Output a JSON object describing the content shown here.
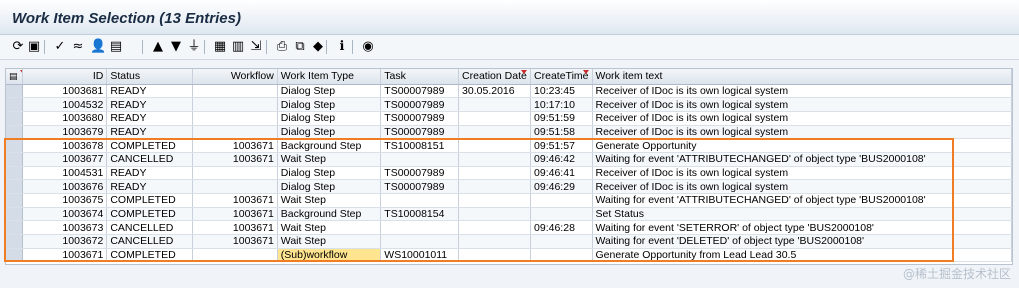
{
  "window": {
    "title": "Work Item Selection (13 Entries)"
  },
  "toolbar": {
    "buttons": [
      {
        "name": "refresh-icon",
        "glyph": "⟳"
      },
      {
        "name": "save-icon",
        "glyph": "▣"
      },
      {
        "name": "execute-icon",
        "glyph": "✓"
      },
      {
        "name": "workflow-log-icon",
        "glyph": "≈"
      },
      {
        "name": "agent-icon",
        "glyph": "👤"
      },
      {
        "name": "details-icon",
        "glyph": "▤"
      },
      {
        "name": "sort-ascending-icon",
        "glyph": "▲"
      },
      {
        "name": "sort-descending-icon",
        "glyph": "▼"
      },
      {
        "name": "filter-icon",
        "glyph": "⏚"
      },
      {
        "name": "layout-icon",
        "glyph": "▦"
      },
      {
        "name": "spreadsheet-icon",
        "glyph": "▥"
      },
      {
        "name": "export-icon",
        "glyph": "⇲"
      },
      {
        "name": "print-icon",
        "glyph": "⎙"
      },
      {
        "name": "views-icon",
        "glyph": "⧉"
      },
      {
        "name": "graphic-icon",
        "glyph": "◆"
      },
      {
        "name": "info-icon",
        "glyph": "ℹ"
      },
      {
        "name": "disk-icon",
        "glyph": "◉"
      }
    ]
  },
  "table": {
    "columns": [
      "ID",
      "Status",
      "Workflow",
      "Work Item Type",
      "Task",
      "Creation Date",
      "CreateTime",
      "Work item text"
    ],
    "rows": [
      {
        "id": "1003681",
        "status": "READY",
        "workflow": "",
        "type": "Dialog Step",
        "task": "TS00007989",
        "date": "30.05.2016",
        "time": "10:23:45",
        "text": "Receiver of IDoc is its own logical system"
      },
      {
        "id": "1004532",
        "status": "READY",
        "workflow": "",
        "type": "Dialog Step",
        "task": "TS00007989",
        "date": "",
        "time": "10:17:10",
        "text": "Receiver of IDoc is its own logical system"
      },
      {
        "id": "1003680",
        "status": "READY",
        "workflow": "",
        "type": "Dialog Step",
        "task": "TS00007989",
        "date": "",
        "time": "09:51:59",
        "text": "Receiver of IDoc is its own logical system"
      },
      {
        "id": "1003679",
        "status": "READY",
        "workflow": "",
        "type": "Dialog Step",
        "task": "TS00007989",
        "date": "",
        "time": "09:51:58",
        "text": "Receiver of IDoc is its own logical system"
      },
      {
        "id": "1003678",
        "status": "COMPLETED",
        "workflow": "1003671",
        "type": "Background Step",
        "task": "TS10008151",
        "date": "",
        "time": "09:51:57",
        "text": "Generate Opportunity"
      },
      {
        "id": "1003677",
        "status": "CANCELLED",
        "workflow": "1003671",
        "type": "Wait Step",
        "task": "",
        "date": "",
        "time": "09:46:42",
        "text": "Waiting for event 'ATTRIBUTECHANGED' of object type 'BUS2000108'"
      },
      {
        "id": "1004531",
        "status": "READY",
        "workflow": "",
        "type": "Dialog Step",
        "task": "TS00007989",
        "date": "",
        "time": "09:46:41",
        "text": "Receiver of IDoc is its own logical system"
      },
      {
        "id": "1003676",
        "status": "READY",
        "workflow": "",
        "type": "Dialog Step",
        "task": "TS00007989",
        "date": "",
        "time": "09:46:29",
        "text": "Receiver of IDoc is its own logical system"
      },
      {
        "id": "1003675",
        "status": "COMPLETED",
        "workflow": "1003671",
        "type": "Wait Step",
        "task": "",
        "date": "",
        "time": "",
        "text": "Waiting for event 'ATTRIBUTECHANGED' of object type 'BUS2000108'"
      },
      {
        "id": "1003674",
        "status": "COMPLETED",
        "workflow": "1003671",
        "type": "Background Step",
        "task": "TS10008154",
        "date": "",
        "time": "",
        "text": "Set Status"
      },
      {
        "id": "1003673",
        "status": "CANCELLED",
        "workflow": "1003671",
        "type": "Wait Step",
        "task": "",
        "date": "",
        "time": "09:46:28",
        "text": "Waiting for event 'SETERROR' of object type 'BUS2000108'"
      },
      {
        "id": "1003672",
        "status": "CANCELLED",
        "workflow": "1003671",
        "type": "Wait Step",
        "task": "",
        "date": "",
        "time": "",
        "text": "Waiting for event 'DELETED' of object type 'BUS2000108'"
      },
      {
        "id": "1003671",
        "status": "COMPLETED",
        "workflow": "",
        "type": "(Sub)workflow",
        "task": "WS10001011",
        "date": "",
        "time": "",
        "text": "Generate Opportunity from Lead Lead 30.5"
      }
    ]
  },
  "watermark": "@稀土掘金技术社区",
  "colors": {
    "highlight_border": "#f07c24",
    "selected_cell": "#ffe58f",
    "sort_marker": "#cc2a2a"
  }
}
